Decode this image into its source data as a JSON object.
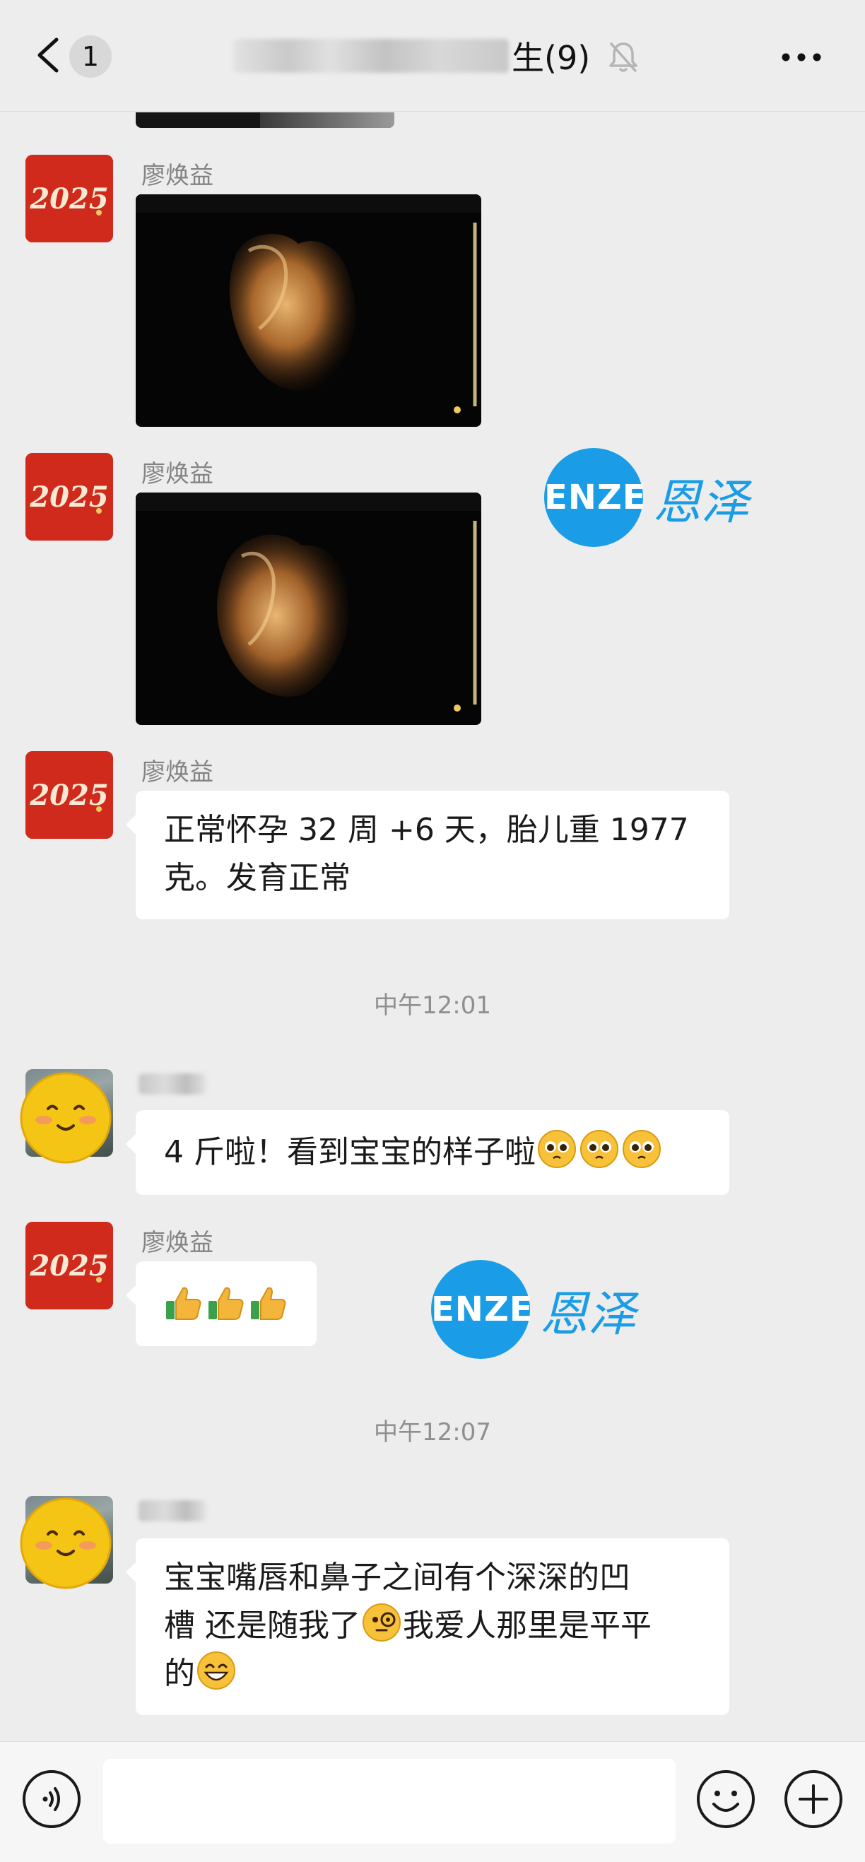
{
  "header": {
    "unread_count": "1",
    "title_visible": "生(9)"
  },
  "messages": [
    {
      "type": "image",
      "sender": "廖焕益",
      "image_desc": "ultrasound-3d"
    },
    {
      "type": "image",
      "sender": "廖焕益",
      "image_desc": "ultrasound-3d"
    },
    {
      "type": "text",
      "sender": "廖焕益",
      "text_line1": "正常怀孕 32 周 +6 天，胎儿重 1977",
      "text_line2": "克。发育正常"
    },
    {
      "type": "time",
      "text": "中午12:01"
    },
    {
      "type": "text",
      "sender_hidden": true,
      "text": "4 斤啦！看到宝宝的样子啦"
    },
    {
      "type": "emoji",
      "sender": "廖焕益",
      "emoji": "thumbs-up x3"
    },
    {
      "type": "time",
      "text": "中午12:07"
    },
    {
      "type": "text",
      "sender_hidden": true,
      "text_line1": "宝宝嘴唇和鼻子之间有个深深的凹",
      "text_line2": "槽 还是随我了",
      "text_line2b": "我爱人那里是平平",
      "text_line3": "的"
    }
  ],
  "watermark": {
    "logo_text": "ENZE",
    "cn_text": "恩泽"
  },
  "input": {
    "value": "",
    "placeholder": ""
  },
  "colors": {
    "background": "#ededed",
    "bubble": "#ffffff",
    "avatar_red": "#d02a1c",
    "watermark_blue": "#1a9de6",
    "timestamp": "#8f8f8f",
    "sender_name": "#838383"
  },
  "icons": [
    "back-arrow-icon",
    "mute-bell-icon",
    "more-dots-icon",
    "voice-icon",
    "emoji-icon",
    "plus-icon",
    "smiley-avatar-icon",
    "thumbs-up-icon",
    "pleading-face-icon",
    "monocle-face-icon",
    "grin-face-icon"
  ]
}
